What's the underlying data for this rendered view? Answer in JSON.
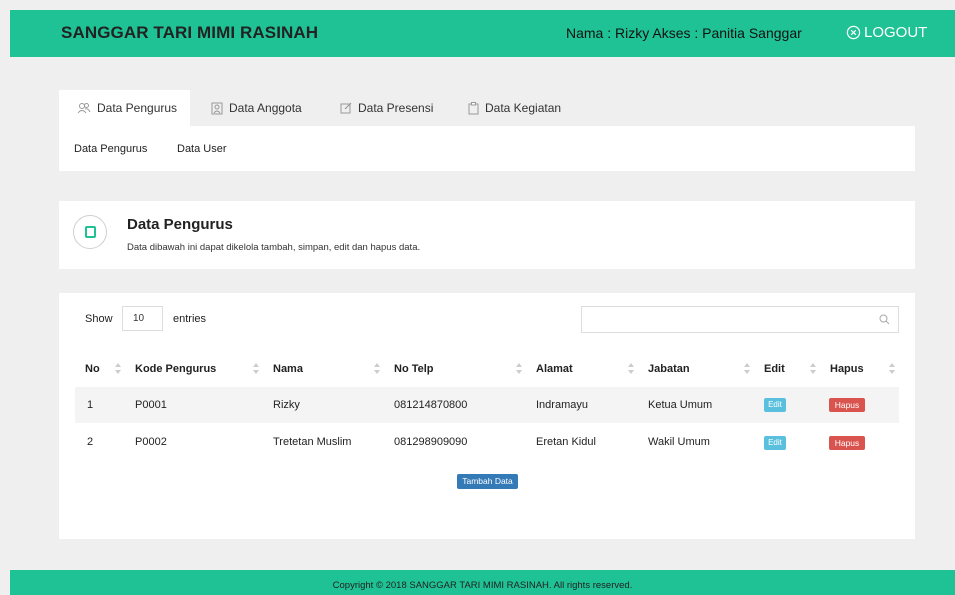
{
  "header": {
    "brand": "SANGGAR TARI MIMI RASINAH",
    "user_info": "Nama : Rizky Akses : Panitia Sanggar",
    "logout_label": "LOGOUT"
  },
  "tabs": [
    {
      "label": "Data Pengurus",
      "icon": "people-icon",
      "active": true
    },
    {
      "label": "Data Anggota",
      "icon": "user-icon",
      "active": false
    },
    {
      "label": "Data Presensi",
      "icon": "edit-icon",
      "active": false
    },
    {
      "label": "Data Kegiatan",
      "icon": "clipboard-icon",
      "active": false
    }
  ],
  "subnav": [
    "Data Pengurus",
    "Data User"
  ],
  "page": {
    "title": "Data Pengurus",
    "description": "Data dibawah ini dapat dikelola tambah, simpan, edit dan hapus data."
  },
  "table_controls": {
    "show_label": "Show",
    "entries_value": "10",
    "entries_label": "entries",
    "search_value": ""
  },
  "table": {
    "columns": [
      "No",
      "Kode Pengurus",
      "Nama",
      "No Telp",
      "Alamat",
      "Jabatan",
      "Edit",
      "Hapus"
    ],
    "rows": [
      {
        "no": "1",
        "kode": "P0001",
        "nama": "Rizky",
        "telp": "081214870800",
        "alamat": "Indramayu",
        "jabatan": "Ketua Umum",
        "edit": "Edit",
        "hapus": "Hapus"
      },
      {
        "no": "2",
        "kode": "P0002",
        "nama": "Tretetan Muslim",
        "telp": "081298909090",
        "alamat": "Eretan Kidul",
        "jabatan": "Wakil Umum",
        "edit": "Edit",
        "hapus": "Hapus"
      }
    ],
    "add_button": "Tambah Data"
  },
  "footer": {
    "text": "Copyright © 2018 SANGGAR TARI MIMI RASINAH. All rights reserved."
  },
  "colors": {
    "accent": "#1fc295",
    "edit": "#5bc0de",
    "delete": "#d9534f",
    "primary": "#337ab7"
  }
}
